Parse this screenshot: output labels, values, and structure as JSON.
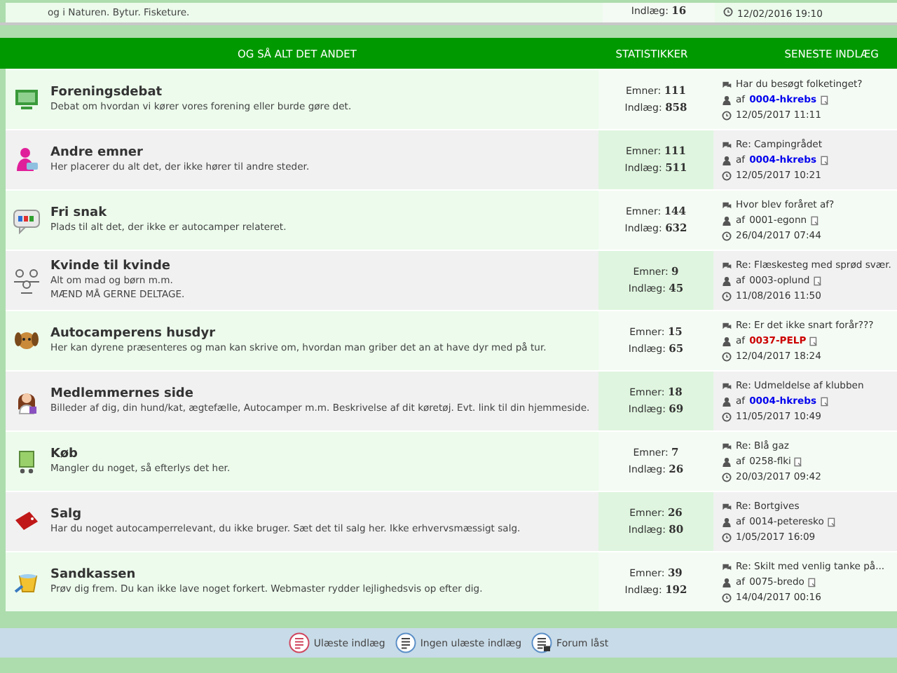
{
  "previous_forum": {
    "description": "og i Naturen. Bytur. Fisketure.",
    "posts_label": "Indlæg:",
    "posts": "16",
    "date": "12/02/2016 19:10"
  },
  "header": {
    "title": "OG SÅ ALT DET ANDET",
    "stats": "STATISTIKKER",
    "latest": "SENESTE INDLÆG"
  },
  "forums": [
    {
      "title": "Foreningsdebat",
      "description": [
        "Debat om hvordan vi kører vores forening eller burde gøre det."
      ],
      "topics_label": "Emner:",
      "topics": "111",
      "posts_label": "Indlæg:",
      "posts": "858",
      "last_subject": "Har du besøgt folketinget?",
      "by": "af",
      "author": {
        "name": "0004-hkrebs",
        "color": "#0000ee"
      },
      "date": "12/05/2017 11:11"
    },
    {
      "title": "Andre emner",
      "description": [
        "Her placerer du alt det, der ikke hører til andre steder."
      ],
      "topics_label": "Emner:",
      "topics": "111",
      "posts_label": "Indlæg:",
      "posts": "511",
      "last_subject": "Re: Campingrådet",
      "by": "af",
      "author": {
        "name": "0004-hkrebs",
        "color": "#0000ee"
      },
      "date": "12/05/2017 10:21"
    },
    {
      "title": "Fri snak",
      "description": [
        "Plads til alt det, der ikke er autocamper relateret."
      ],
      "topics_label": "Emner:",
      "topics": "144",
      "posts_label": "Indlæg:",
      "posts": "632",
      "last_subject": "Hvor blev foråret af?",
      "by": "af",
      "author": {
        "name": "0001-egonn"
      },
      "date": "26/04/2017 07:44"
    },
    {
      "title": "Kvinde til kvinde",
      "description": [
        "Alt om mad og børn m.m.",
        "MÆND MÅ GERNE DELTAGE."
      ],
      "topics_label": "Emner:",
      "topics": "9",
      "posts_label": "Indlæg:",
      "posts": "45",
      "last_subject": "Re: Flæskesteg med sprød svær.",
      "by": "af",
      "author": {
        "name": "0003-oplund"
      },
      "date": "11/08/2016 11:50"
    },
    {
      "title": "Autocamperens husdyr",
      "description": [
        "Her kan dyrene præsenteres og man kan skrive om, hvordan man griber det an at have dyr med på tur."
      ],
      "topics_label": "Emner:",
      "topics": "15",
      "posts_label": "Indlæg:",
      "posts": "65",
      "last_subject": "Re: Er det ikke snart forår???",
      "by": "af",
      "author": {
        "name": "0037-PELP",
        "color": "#cc0000"
      },
      "date": "12/04/2017 18:24"
    },
    {
      "title": "Medlemmernes side",
      "description": [
        "Billeder af dig, din hund/kat, ægtefælle, Autocamper m.m. Beskrivelse af dit køretøj. Evt. link til din hjemmeside."
      ],
      "topics_label": "Emner:",
      "topics": "18",
      "posts_label": "Indlæg:",
      "posts": "69",
      "last_subject": "Re: Udmeldelse af klubben",
      "by": "af",
      "author": {
        "name": "0004-hkrebs",
        "color": "#0000ee"
      },
      "date": "11/05/2017 10:49"
    },
    {
      "title": "Køb",
      "description": [
        "Mangler du noget, så efterlys det her."
      ],
      "topics_label": "Emner:",
      "topics": "7",
      "posts_label": "Indlæg:",
      "posts": "26",
      "last_subject": "Re: Blå gaz",
      "by": "af",
      "author": {
        "name": "0258-flki"
      },
      "date": "20/03/2017 09:42"
    },
    {
      "title": "Salg",
      "description": [
        "Har du noget autocamperrelevant, du ikke bruger. Sæt det til salg her. Ikke erhvervsmæssigt salg."
      ],
      "topics_label": "Emner:",
      "topics": "26",
      "posts_label": "Indlæg:",
      "posts": "80",
      "last_subject": "Re: Bortgives",
      "by": "af",
      "author": {
        "name": "0014-peteresko"
      },
      "date": "1/05/2017 16:09"
    },
    {
      "title": "Sandkassen",
      "description": [
        "Prøv dig frem. Du kan ikke lave noget forkert. Webmaster rydder lejlighedsvis op efter dig."
      ],
      "topics_label": "Emner:",
      "topics": "39",
      "posts_label": "Indlæg:",
      "posts": "192",
      "last_subject": "Re: Skilt med venlig tanke på...",
      "by": "af",
      "author": {
        "name": "0075-bredo"
      },
      "date": "14/04/2017 00:16"
    }
  ],
  "legend": [
    {
      "kind": "unread",
      "label": "Ulæste indlæg"
    },
    {
      "kind": "read",
      "label": "Ingen ulæste indlæg"
    },
    {
      "kind": "locked",
      "label": "Forum låst"
    }
  ]
}
